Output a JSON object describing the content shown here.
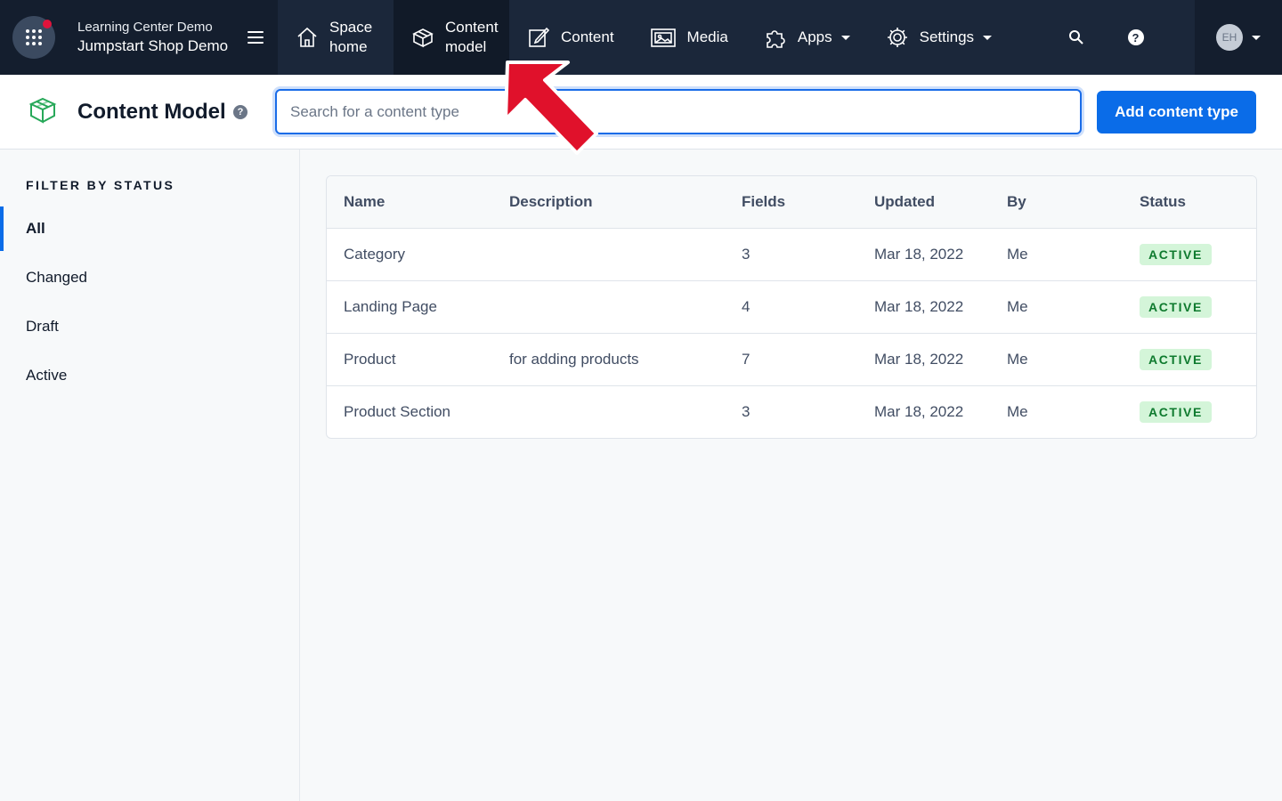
{
  "space": {
    "org": "Learning Center Demo",
    "name": "Jumpstart Shop Demo"
  },
  "nav": {
    "space_home": "Space home",
    "content_model": "Content model",
    "content": "Content",
    "media": "Media",
    "apps": "Apps",
    "settings": "Settings"
  },
  "account": {
    "initials": "EH"
  },
  "header": {
    "title": "Content Model",
    "search_placeholder": "Search for a content type",
    "add_button": "Add content type"
  },
  "sidebar": {
    "heading": "FILTER BY STATUS",
    "items": [
      {
        "label": "All",
        "active": true
      },
      {
        "label": "Changed"
      },
      {
        "label": "Draft"
      },
      {
        "label": "Active"
      }
    ]
  },
  "table": {
    "columns": [
      "Name",
      "Description",
      "Fields",
      "Updated",
      "By",
      "Status"
    ],
    "rows": [
      {
        "name": "Category",
        "description": "",
        "fields": "3",
        "updated": "Mar 18, 2022",
        "by": "Me",
        "status": "ACTIVE"
      },
      {
        "name": "Landing Page",
        "description": "",
        "fields": "4",
        "updated": "Mar 18, 2022",
        "by": "Me",
        "status": "ACTIVE"
      },
      {
        "name": "Product",
        "description": "for adding products",
        "fields": "7",
        "updated": "Mar 18, 2022",
        "by": "Me",
        "status": "ACTIVE"
      },
      {
        "name": "Product Section",
        "description": "",
        "fields": "3",
        "updated": "Mar 18, 2022",
        "by": "Me",
        "status": "ACTIVE"
      }
    ]
  },
  "colors": {
    "nav_bg": "#1b273a",
    "accent": "#0a6ce8",
    "badge_bg": "#d4f5d9",
    "badge_text": "#0e7a2e",
    "annotation_arrow": "#e0112b"
  }
}
